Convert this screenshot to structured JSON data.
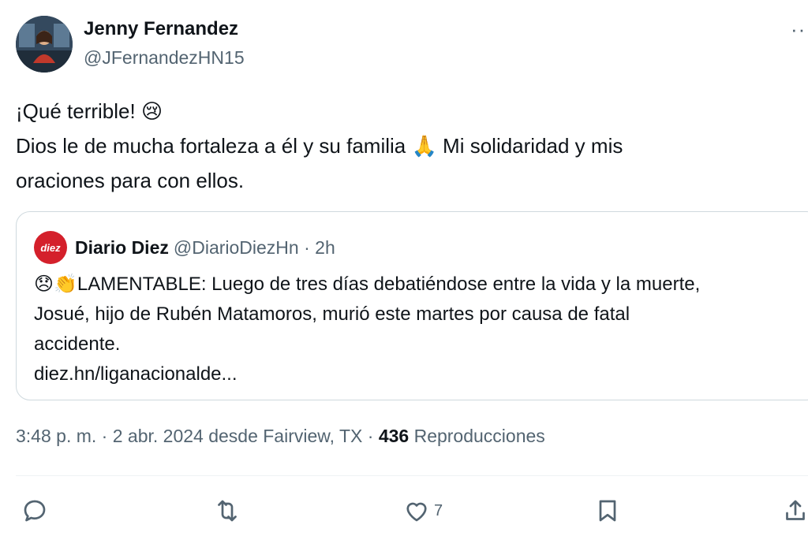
{
  "author": {
    "name": "Jenny Fernandez",
    "handle": "@JFernandezHN15"
  },
  "more_label": "··",
  "tweet": {
    "line1": "¡Qué terrible! ",
    "emoji1": "😢",
    "line2a": "Dios le de mucha fortaleza a él y su familia ",
    "emoji2": "🙏",
    "line2b": " Mi solidaridad y mis",
    "line3": "oraciones para con ellos."
  },
  "quote": {
    "logo_text": "diez",
    "name": "Diario Diez",
    "handle_time": "@DiarioDiezHn · 2h",
    "emojis": "😞👏",
    "text_line1": "LAMENTABLE: Luego de tres días debatiéndose entre la vida y la muerte,",
    "text_line2": "Josué, hijo de Rubén Matamoros, murió este martes por causa de fatal",
    "text_line3": "accidente.",
    "link": "diez.hn/liganacionalde..."
  },
  "meta": {
    "time_date": "3:48 p. m. · 2 abr. 2024 desde Fairview, TX · ",
    "views_count": "436",
    "views_label": " Reproducciones"
  },
  "actions": {
    "reply_icon": "reply-icon",
    "retweet_icon": "retweet-icon",
    "like_icon": "heart-icon",
    "like_count": "7",
    "bookmark_icon": "bookmark-icon",
    "share_icon": "share-icon"
  }
}
